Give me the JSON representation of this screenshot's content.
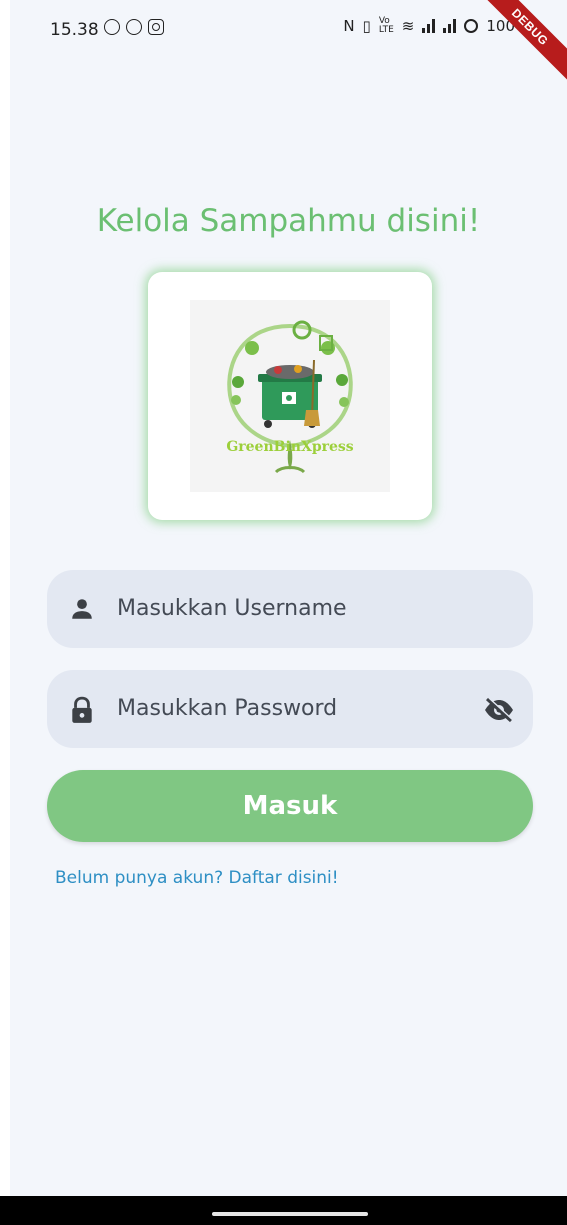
{
  "status_bar": {
    "time": "15.38",
    "right_text": "100",
    "left_icons": [
      "whatsapp-icon",
      "app-icon",
      "instagram-icon"
    ],
    "right_icons": [
      "nfc-icon",
      "vibrate-icon",
      "volte-icon",
      "wifi-icon",
      "signal-icon",
      "signal-icon",
      "battery-ring-icon"
    ]
  },
  "debug_banner": "DEBUG",
  "header": {
    "title": "Kelola Sampahmu disini!"
  },
  "logo": {
    "text": "GreenBinXpress"
  },
  "form": {
    "username_placeholder": "Masukkan Username",
    "password_placeholder": "Masukkan Password",
    "username_icon": "person-icon",
    "password_icon": "lock-icon",
    "visibility_icon": "eye-off-icon"
  },
  "login_button": "Masuk",
  "register_link": "Belum punya akun? Daftar disini!",
  "colors": {
    "accent_green": "#6bbf72",
    "button_green": "#80c783",
    "link_blue": "#2e8fc4",
    "field_bg": "#e3e8f2",
    "page_bg": "#f3f6fb"
  }
}
